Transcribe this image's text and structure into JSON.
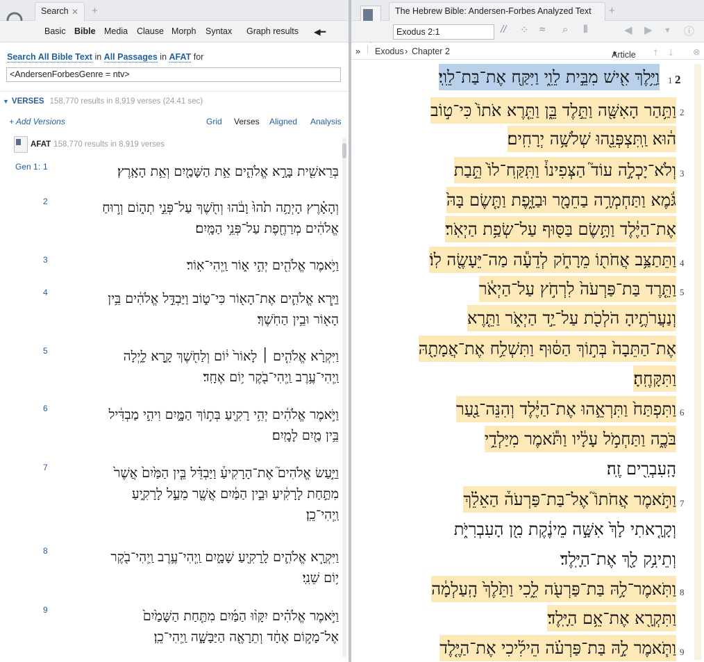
{
  "left": {
    "tab": {
      "label": "Search"
    },
    "menu": [
      "Basic",
      "Bible",
      "Media",
      "Clause",
      "Morph",
      "Syntax",
      "Graph results"
    ],
    "search_for": {
      "p1": "Search All Bible Text",
      "p2": "in",
      "p3": "All Passages",
      "p4": "in",
      "p5": "AFAT",
      "p6": "for"
    },
    "query": "<AndersenForbesGenre = ntv>",
    "verses_header": {
      "label": "VERSES",
      "count": "158,770 results in 8,919 verses (24.41 sec)"
    },
    "add_versions": "+ Add Versions",
    "view_tabs": [
      "Grid",
      "Verses",
      "Aligned",
      "Analysis"
    ],
    "resource": {
      "name": "AFAT",
      "count": "158,770 results in 8,919 verses"
    },
    "ref_book": "Gen 1:",
    "verses": [
      {
        "num": "1",
        "lines": [
          "בְּרֵאשִׁ֖ית בָּרָ֣א אֱלֹהִ֑ים אֵ֥ת הַשָּׁמַ֖יִם וְאֵ֥ת הָאָֽרֶץ׃"
        ]
      },
      {
        "num": "2",
        "lines": [
          "וְהָאָ֗רֶץ הָיְתָ֥ה תֹ֙הוּ֙ וָבֹ֔הוּ וְחֹ֖שֶׁךְ עַל־פְּנֵ֣י תְה֑וֹם וְר֣וּחַ",
          "אֱלֹהִ֔ים מְרַחֶ֖פֶת עַל־פְּנֵ֥י הַמָּֽיִם׃"
        ]
      },
      {
        "num": "3",
        "lines": [
          "וַיֹּ֥אמֶר אֱלֹהִ֖ים יְהִ֣י א֑וֹר וַֽיְהִי־אֽוֹר׃"
        ]
      },
      {
        "num": "4",
        "lines": [
          "וַיַּ֧רְא אֱלֹהִ֛ים אֶת־הָא֖וֹר כִּי־ט֑וֹב וַיַּבְדֵּ֣ל אֱלֹהִ֔ים בֵּ֥ין",
          "הָא֖וֹר וּבֵ֥ין הַחֹֽשֶׁךְ׃"
        ]
      },
      {
        "num": "5",
        "lines": [
          "וַיִּקְרָ֨א אֱלֹהִ֤ים ׀ לָאוֹר֙ י֔וֹם וְלַחֹ֖שֶׁךְ קָ֣רָא לָ֑יְלָה",
          "וַֽיְהִי־עֶ֥רֶב וַֽיְהִי־בֹ֖קֶר י֥וֹם אֶחָֽד׃"
        ]
      },
      {
        "num": "6",
        "lines": [
          "וַיֹּ֣אמֶר אֱלֹהִ֔ים יְהִ֥י רָקִ֖יעַ בְּת֣וֹךְ הַמָּ֑יִם וִיהִ֣י מַבְדִּ֔יל",
          "בֵּ֥ין מַ֖יִם לָמָֽיִם׃"
        ]
      },
      {
        "num": "7",
        "lines": [
          "וַיַּ֣עַשׂ אֱלֹהִים֮ אֶת־הָרָקִיעַ֒ וַיַּבְדֵּ֗ל בֵּ֤ין הַמַּ֙יִם֙ אֲשֶׁר֙",
          "מִתַּ֣חַת לָרָקִ֔יעַ וּבֵ֣ין הַמַּ֔יִם אֲשֶׁ֖ר מֵעַ֣ל לָרָקִ֑יעַ",
          "וַֽיְהִי־כֵֽן׃"
        ]
      },
      {
        "num": "8",
        "lines": [
          "וַיִּקְרָ֧א אֱלֹהִ֛ים לָֽרָקִ֖יעַ שָׁמָ֑יִם וַֽיְהִי־עֶ֥רֶב וַֽיְהִי־בֹ֖קֶר",
          "י֥וֹם שֵׁנִֽי׃"
        ]
      },
      {
        "num": "9",
        "lines": [
          "וַיֹּ֣אמֶר אֱלֹהִ֗ים יִקָּו֨וּ הַמַּ֜יִם מִתַּ֤חַת הַשָּׁמַ֙יִם֙",
          "אֶל־מָק֣וֹם אֶחָ֔ד וְתֵרָאֶ֖ה הַיַּבָּשָׁ֑ה וַֽיְהִי־כֵֽן׃"
        ]
      }
    ]
  },
  "right": {
    "tab": {
      "label": "The Hebrew Bible: Andersen-Forbes Analyzed Text"
    },
    "reference": "Exodus 2:1",
    "breadcrumb": {
      "book": "Exodus",
      "chapter": "Chapter 2",
      "layout": "Article"
    },
    "chapter_number": "2",
    "verses": [
      {
        "num": "1",
        "lines": [
          "וַיֵּ֥לֶךְ אִ֖ישׁ מִבֵּ֣ית לֵוִ֑י וַיִּקַּ֖ח אֶת־בַּת־לֵוִֽי׃"
        ]
      },
      {
        "num": "2",
        "lines": [
          "וַתַּ֥הַר הָאִשָּׁ֖ה וַתֵּ֣לֶד בֵּ֑ן וַתֵּ֤רֶא אֹתוֹ֙ כִּי־ט֣וֹב",
          "ה֔וּא וַֽתִּצְפְּנֵ֖הוּ שְׁלֹשָׁ֥ה יְרָחִֽים׃"
        ]
      },
      {
        "num": "3",
        "lines": [
          "וְלֹא־יָכְלָ֣ה עוֹד֮ הַצְּפִינוֹ֒ וַתִּֽקַּֽח־לוֹ֙ תֵּ֣בַת",
          "גֹּ֔מֶא וַתַּחְמְרָ֥ה בַחֵמָ֖ר וּבַזָּ֑פֶת וַתָּ֤שֶׂם בָּהּ֙",
          "אֶת־הַיֶּ֔לֶד וַתָּ֥שֶׂם בַּסּ֖וּף עַל־שְׂפַ֥ת הַיְאֹֽר׃"
        ]
      },
      {
        "num": "4",
        "lines": [
          "וַתֵּתַצַּ֥ב אֲחֹת֖וֹ מֵרָחֹ֑ק לְדֵעָ֕ה מַה־יֵּעָשֶׂ֖ה לֽוֹ׃"
        ]
      },
      {
        "num": "5",
        "lines": [
          "וַתֵּ֤רֶד בַּת־פַּרְעֹה֙ לִרְחֹ֣ץ עַל־הַיְאֹ֔ר",
          "וְנַעֲרֹתֶ֥יהָ הֹלְכֹ֖ת עַל־יַ֣ד הַיְאֹ֑ר וַתֵּ֤רֶא",
          "אֶת־הַתֵּבָה֙ בְּת֣וֹךְ הַסּ֔וּף וַתִּשְׁלַ֥ח אֶת־אֲמָתָ֖הּ",
          "וַתִּקָּחֶֽהָ׃"
        ]
      },
      {
        "num": "6",
        "lines": [
          "וַתִּפְתַּח֙ וַתִּרְאֵ֣הוּ אֶת־הַיֶּ֔לֶד וְהִנֵּה־נַ֖עַר",
          "בֹּכֶ֑ה וַתַּחְמֹ֣ל עָלָ֔יו וַתֹּ֕אמֶר מִיַּלְדֵ֥י",
          "הָֽעִבְרִ֖ים זֶֽה׃"
        ]
      },
      {
        "num": "7",
        "lines": [
          "וַתֹּ֣אמֶר אֲחֹתוֹ֮ אֶל־בַּת־פַּרְעֹה֒ הַאֵלֵ֗ךְ",
          "וְקָרָ֤אתִי לָךְ֙ אִשָּׁ֣ה מֵינֶ֔קֶת מִ֖ן הָעִבְרִיֹּ֑ת",
          "וְתֵינִ֥ק לָ֖ךְ אֶת־הַיָּֽלֶד׃"
        ]
      },
      {
        "num": "8",
        "lines": [
          "וַתֹּֽאמֶר־לָ֥הּ בַּת־פַּרְעֹ֖ה לֵ֑כִי וַתֵּ֙לֶךְ֙ הָֽעַלְמָ֔ה",
          "וַתִּקְרָ֖א אֶת־אֵ֥ם הַיָּֽלֶד׃"
        ]
      },
      {
        "num": "9",
        "lines": [
          "וַתֹּ֧אמֶר לָ֣הּ בַּת־פַּרְעֹ֗ה הֵילִ֜יכִי אֶת־הַיֶּ֤לֶד"
        ]
      }
    ]
  }
}
